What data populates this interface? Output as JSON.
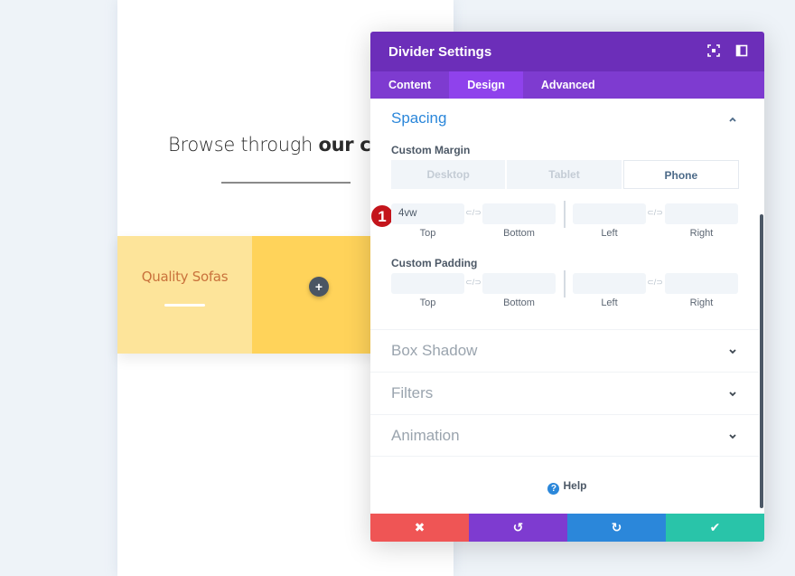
{
  "page": {
    "heading_light": "Browse through ",
    "heading_bold": "our catalo",
    "card_title": "Quality Sofas",
    "add_button_symbol": "+",
    "colors": {
      "background": "#eef3f8",
      "card_light": "#fde49a",
      "card_dark": "#ffd35a",
      "card_title": "#c9723c"
    }
  },
  "modal": {
    "title": "Divider Settings",
    "header_icons": [
      "expand-icon",
      "sidebar-layout-icon"
    ],
    "tabs": [
      {
        "label": "Content",
        "active": false
      },
      {
        "label": "Design",
        "active": true
      },
      {
        "label": "Advanced",
        "active": false
      }
    ],
    "spacing": {
      "title": "Spacing",
      "expanded": true,
      "custom_margin": {
        "label": "Custom Margin",
        "device_tabs": [
          {
            "label": "Desktop",
            "active": false
          },
          {
            "label": "Tablet",
            "active": false
          },
          {
            "label": "Phone",
            "active": true
          }
        ],
        "fields": {
          "top": {
            "label": "Top",
            "value": "4vw"
          },
          "bottom": {
            "label": "Bottom",
            "value": ""
          },
          "left": {
            "label": "Left",
            "value": ""
          },
          "right": {
            "label": "Right",
            "value": ""
          }
        }
      },
      "custom_padding": {
        "label": "Custom Padding",
        "fields": {
          "top": {
            "label": "Top",
            "value": ""
          },
          "bottom": {
            "label": "Bottom",
            "value": ""
          },
          "left": {
            "label": "Left",
            "value": ""
          },
          "right": {
            "label": "Right",
            "value": ""
          }
        }
      },
      "link_symbol": "⊂/⊃"
    },
    "step_badge": "1",
    "collapsed_sections": [
      "Box Shadow",
      "Filters",
      "Animation"
    ],
    "help_label": "Help",
    "footer": {
      "cancel_icon": "✖",
      "undo_icon": "↺",
      "redo_icon": "↻",
      "save_icon": "✔"
    },
    "colors": {
      "header": "#6c2eb9",
      "tabs": "#7e3bd0",
      "tab_active": "#8f42ec",
      "accent": "#2b87da",
      "cancel": "#ef5555",
      "undo": "#7e3bd0",
      "redo": "#2b87da",
      "save": "#29c4a9",
      "badge": "#c4151c"
    }
  }
}
